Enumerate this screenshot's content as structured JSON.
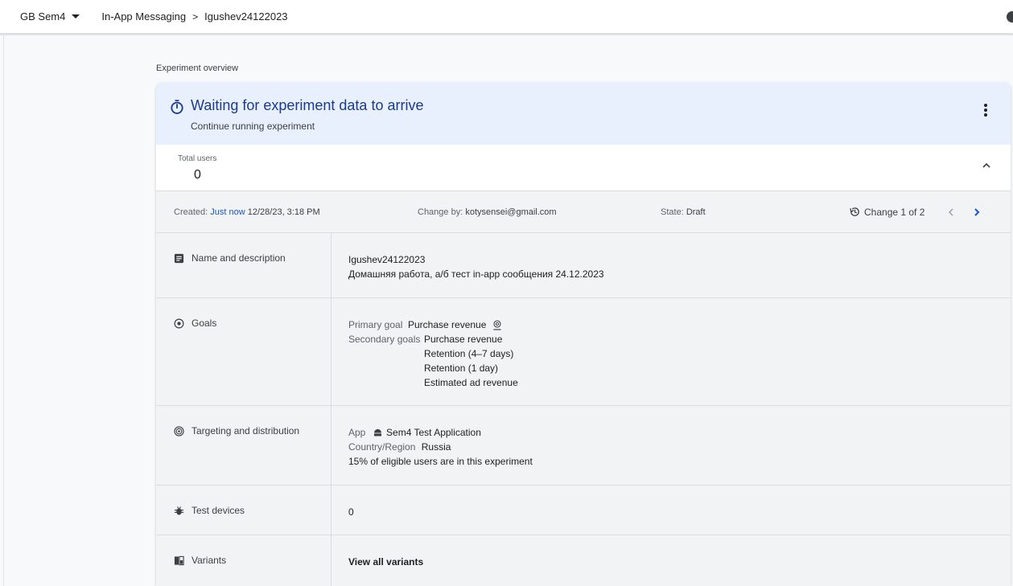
{
  "header": {
    "project": "GB Sem4",
    "breadcrumb": [
      "In-App Messaging",
      "Igushev24122023"
    ],
    "breadcrumb_separator": ">"
  },
  "section_label": "Experiment overview",
  "banner": {
    "title": "Waiting for experiment data to arrive",
    "subtitle": "Continue running experiment",
    "icon": "timer-icon"
  },
  "stats": {
    "total_users_label": "Total users",
    "total_users_value": "0"
  },
  "meta": {
    "created_label": "Created:",
    "created_link": "Just now",
    "created_time": "12/28/23, 3:18 PM",
    "change_by_label": "Change by:",
    "change_by_value": "kotysensei@gmail.com",
    "state_label": "State:",
    "state_value": "Draft",
    "history_text": "Change 1 of 2"
  },
  "rows": {
    "name": {
      "label": "Name and description",
      "name": "Igushev24122023",
      "description": "Домашняя работа, а/б тест in-app сообщения 24.12.2023"
    },
    "goals": {
      "label": "Goals",
      "primary_label": "Primary goal",
      "primary_value": "Purchase revenue",
      "secondary_label": "Secondary goals",
      "secondary_values": [
        "Purchase revenue",
        "Retention (4–7 days)",
        "Retention (1 day)",
        "Estimated ad revenue"
      ]
    },
    "targeting": {
      "label": "Targeting and distribution",
      "app_label": "App",
      "app_value": "Sem4 Test Application",
      "country_label": "Country/Region",
      "country_value": "Russia",
      "distribution": "15% of eligible users are in this experiment"
    },
    "devices": {
      "label": "Test devices",
      "value": "0"
    },
    "variants": {
      "label": "Variants",
      "link": "View all variants"
    }
  },
  "colors": {
    "accent": "#1a56c4",
    "banner_bg": "#e8f0fe",
    "banner_title": "#1a3a8f"
  }
}
